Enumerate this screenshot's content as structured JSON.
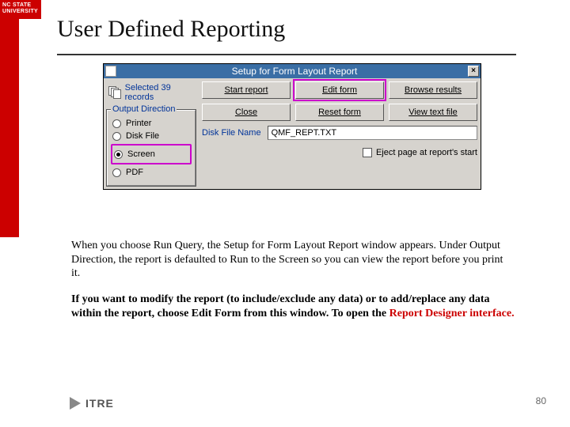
{
  "brand": {
    "line1": "NC STATE",
    "line2": "UNIVERSITY"
  },
  "title": "User Defined Reporting",
  "dialog": {
    "title": "Setup for Form Layout Report",
    "close_label": "×",
    "records_text": "Selected 39 records",
    "group_label": "Output Direction",
    "radios": {
      "printer": "Printer",
      "diskfile": "Disk File",
      "screen": "Screen",
      "pdf": "PDF"
    },
    "buttons": {
      "start": "Start report",
      "edit": "Edit form",
      "browse": "Browse results",
      "close": "Close",
      "reset": "Reset form",
      "viewtext": "View text file"
    },
    "field_label": "Disk File Name",
    "field_value": "QMF_REPT.TXT",
    "eject_label": "Eject page at report's start"
  },
  "para1": "When you choose Run Query, the Setup for Form Layout Report window appears. Under Output Direction, the report is defaulted to Run to the Screen so you can view the report before you print it.",
  "para2_a": "If you want to modify the  report (to include/exclude any data) or to add/replace any data within the report, choose Edit Form from this window. To open the ",
  "para2_b": "Report Designer interface.",
  "footer": {
    "logo": "ITRE",
    "page": "80"
  }
}
